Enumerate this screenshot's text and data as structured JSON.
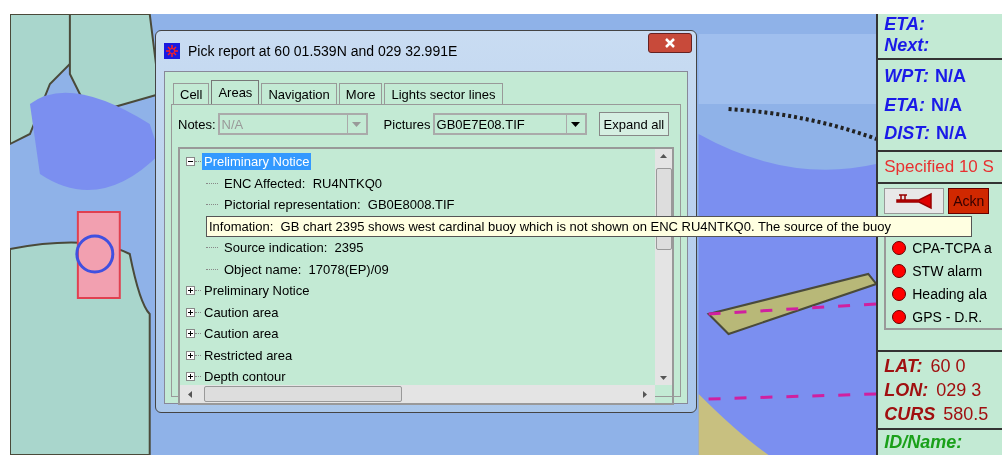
{
  "dialog": {
    "title": "Pick report at 60 01.539N and 029 32.991E",
    "tabs": [
      {
        "label": "Cell",
        "selected": false
      },
      {
        "label": "Areas",
        "selected": true
      },
      {
        "label": "Navigation",
        "selected": false
      },
      {
        "label": "More",
        "selected": false
      },
      {
        "label": "Lights sector lines",
        "selected": false
      }
    ],
    "notes": {
      "label": "Notes:",
      "value": "N/A",
      "disabled": true
    },
    "pictures": {
      "label": "Pictures",
      "value": "GB0E7E08.TIF",
      "disabled": false
    },
    "expand_button": "Expand all",
    "tree": [
      {
        "label": "Preliminary Notice",
        "expanded": true,
        "selected": true,
        "children": [
          {
            "kind": "row",
            "label": "ENC Affected:  RU4NTKQ0"
          },
          {
            "kind": "row",
            "label": "Pictorial representation:  GB0E8008.TIF"
          },
          {
            "kind": "tooltip",
            "label": "Infomation:  GB chart 2395 shows west cardinal buoy which is not shown on ENC RU4NTKQ0. The source of the buoy"
          },
          {
            "kind": "row",
            "label": "Source indication:  2395"
          },
          {
            "kind": "row",
            "label": "Object name:  17078(EP)/09"
          }
        ]
      },
      {
        "label": "Preliminary Notice",
        "expanded": false,
        "selected": false
      },
      {
        "label": "Caution area",
        "expanded": false,
        "selected": false
      },
      {
        "label": "Caution area",
        "expanded": false,
        "selected": false
      },
      {
        "label": "Restricted area",
        "expanded": false,
        "selected": false
      },
      {
        "label": "Depth contour",
        "expanded": false,
        "selected": false
      }
    ]
  },
  "panel": {
    "eta_next": [
      {
        "label": "ETA:"
      },
      {
        "label": "Next:"
      }
    ],
    "route": [
      {
        "label": "WPT:",
        "value": "N/A"
      },
      {
        "label": "ETA:",
        "value": "N/A"
      },
      {
        "label": "DIST:",
        "value": "N/A"
      }
    ],
    "message": "Specified 10 S",
    "acknowledge_button": "Ackn",
    "alarms": [
      {
        "label": "CPA-TCPA a",
        "color": "#ff0000"
      },
      {
        "label": "STW alarm",
        "color": "#ff0000"
      },
      {
        "label": "Heading ala",
        "color": "#ff0000"
      },
      {
        "label": "GPS - D.R.",
        "color": "#ff0000"
      }
    ],
    "position": [
      {
        "label": "LAT:",
        "value": "60 0"
      },
      {
        "label": "LON:",
        "value": "029 3"
      },
      {
        "label": "CURS",
        "value": "580.5"
      }
    ],
    "id_name": "ID/Name:"
  }
}
